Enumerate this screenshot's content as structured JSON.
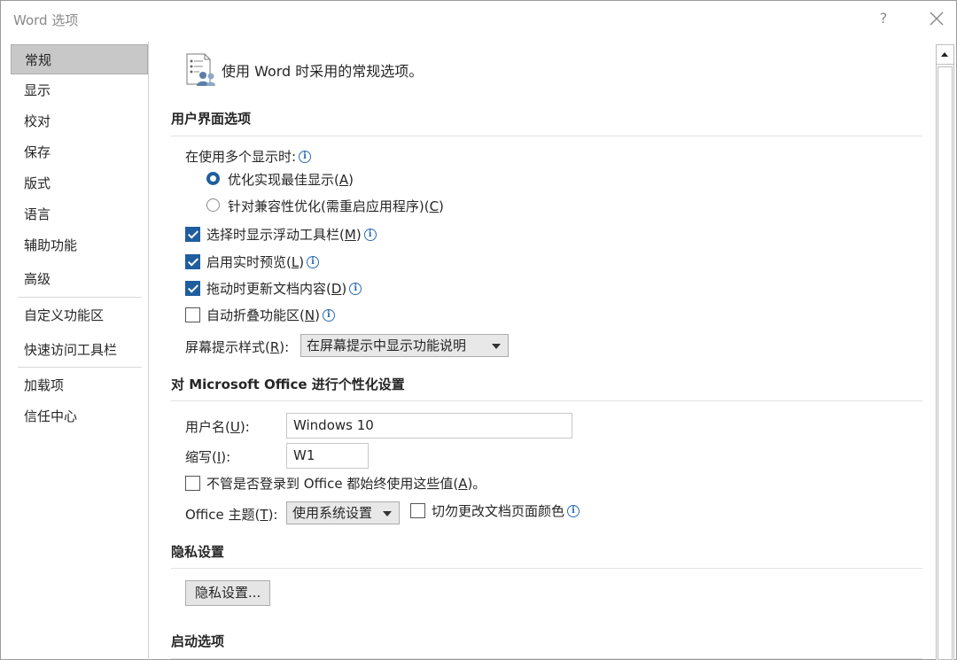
{
  "window": {
    "title": "Word 选项",
    "help_label": "?"
  },
  "sidebar": {
    "items": [
      {
        "label": "常规"
      },
      {
        "label": "显示"
      },
      {
        "label": "校对"
      },
      {
        "label": "保存"
      },
      {
        "label": "版式"
      },
      {
        "label": "语言"
      },
      {
        "label": "辅助功能"
      },
      {
        "label": "高级"
      },
      {
        "label": "自定义功能区"
      },
      {
        "label": "快速访问工具栏"
      },
      {
        "label": "加载项"
      },
      {
        "label": "信任中心"
      }
    ]
  },
  "header": {
    "text": "使用 Word 时采用的常规选项。"
  },
  "ui_section": {
    "title": "用户界面选项",
    "multi_display_label": "在使用多个显示时:",
    "radio_best": {
      "text": "优化实现最佳显示(",
      "key": "A",
      "end": ")"
    },
    "radio_compat": {
      "text": "针对兼容性优化(需重启应用程序)(",
      "key": "C",
      "end": ")"
    },
    "cb_minitoolbar": {
      "text": "选择时显示浮动工具栏(",
      "key": "M",
      "end": ")",
      "checked": true
    },
    "cb_livepreview": {
      "text": "启用实时预览(",
      "key": "L",
      "end": ")",
      "checked": true
    },
    "cb_updatedrag": {
      "text": "拖动时更新文档内容(",
      "key": "D",
      "end": ")",
      "checked": true
    },
    "cb_collapse": {
      "text": "自动折叠功能区(",
      "key": "N",
      "end": ")",
      "checked": false
    },
    "tooltip_label": {
      "text": "屏幕提示样式(",
      "key": "R",
      "end": "):"
    },
    "tooltip_value": "在屏幕提示中显示功能说明"
  },
  "personalize_section": {
    "title": "对 Microsoft Office 进行个性化设置",
    "username_label": {
      "text": "用户名(",
      "key": "U",
      "end": "):"
    },
    "username_value": "Windows 10",
    "initials_label": {
      "text": "缩写(",
      "key": "I",
      "end": "):"
    },
    "initials_value": "W1",
    "cb_always": {
      "text": "不管是否登录到 Office 都始终使用这些值(",
      "key": "A",
      "end": ")。",
      "checked": false
    },
    "theme_label": {
      "text": "Office 主题(",
      "key": "T",
      "end": "):"
    },
    "theme_value": "使用系统设置",
    "cb_nopagecolor": {
      "text": "切勿更改文档页面颜色",
      "checked": false
    }
  },
  "privacy_section": {
    "title": "隐私设置",
    "button": "隐私设置..."
  },
  "startup_section": {
    "title": "启动选项"
  },
  "icons": {
    "info": "i"
  }
}
